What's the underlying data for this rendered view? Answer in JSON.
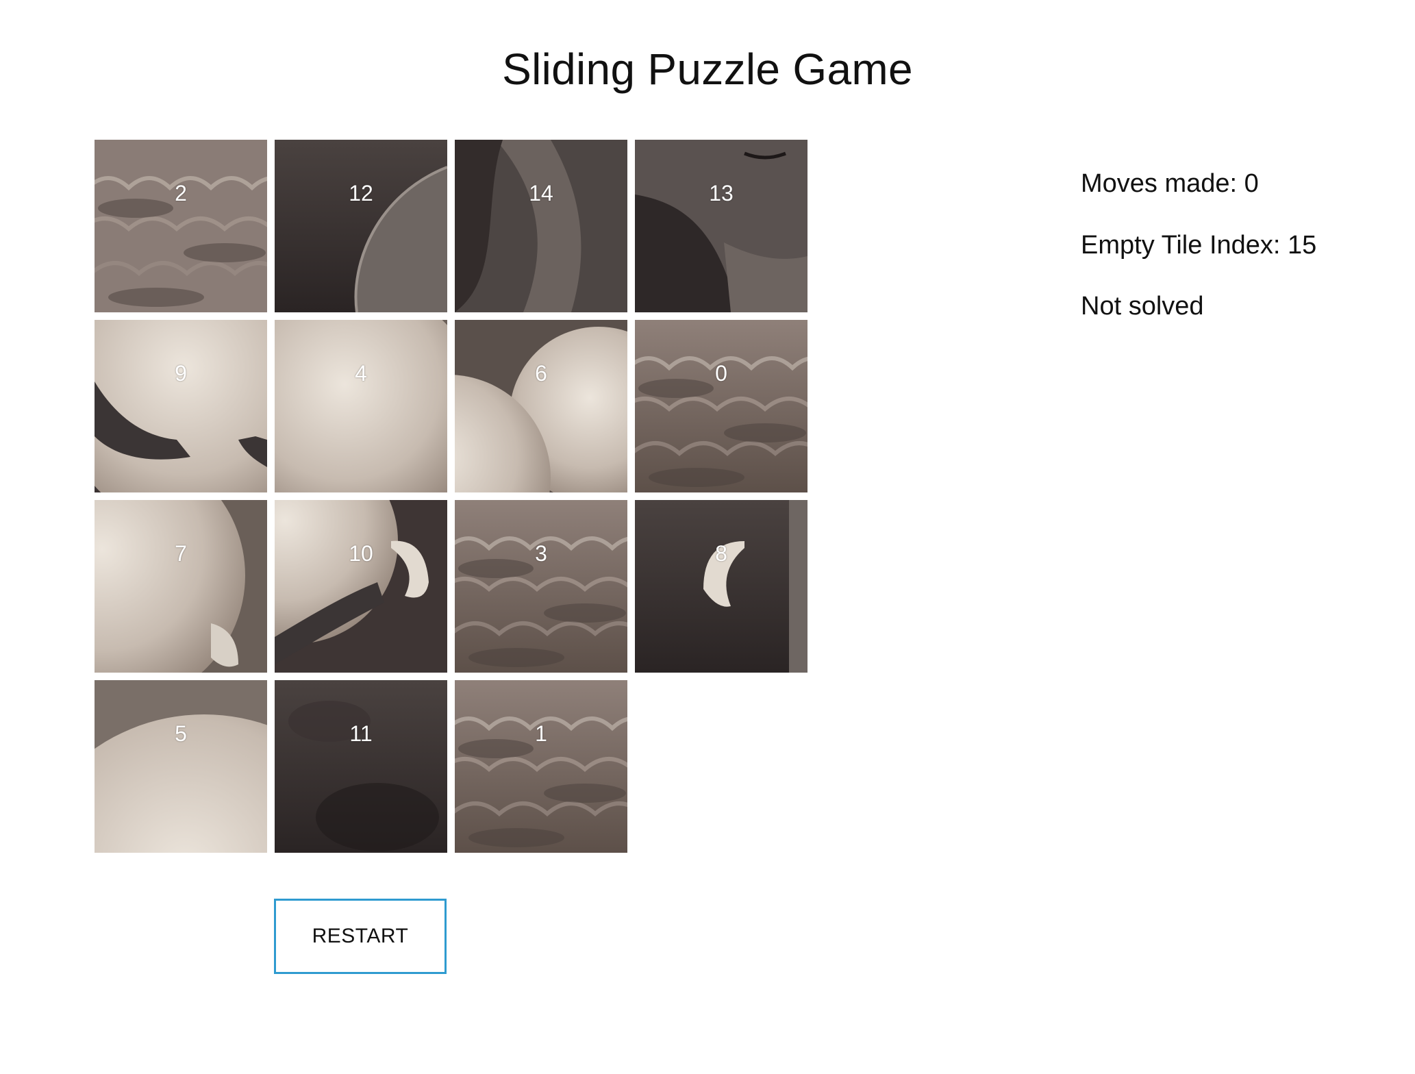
{
  "title": "Sliding Puzzle Game",
  "board": {
    "tiles": [
      {
        "label": "2",
        "theme": "clouds-light"
      },
      {
        "label": "12",
        "theme": "dark-arc"
      },
      {
        "label": "14",
        "theme": "dark-curve"
      },
      {
        "label": "13",
        "theme": "dark-robe"
      },
      {
        "label": "9",
        "theme": "sphere-horns"
      },
      {
        "label": "4",
        "theme": "sphere"
      },
      {
        "label": "6",
        "theme": "sphere-edge"
      },
      {
        "label": "0",
        "theme": "clouds"
      },
      {
        "label": "7",
        "theme": "sphere-ear"
      },
      {
        "label": "10",
        "theme": "sphere-ear-horn"
      },
      {
        "label": "3",
        "theme": "clouds"
      },
      {
        "label": "8",
        "theme": "dark-ear"
      },
      {
        "label": "5",
        "theme": "sphere-bottom"
      },
      {
        "label": "11",
        "theme": "dark"
      },
      {
        "label": "1",
        "theme": "clouds"
      }
    ],
    "empty_slot": "empty"
  },
  "controls": {
    "restart_label": "RESTART",
    "restart_border_color": "#2f9bd0"
  },
  "stats": {
    "moves_text": "Moves made: 0",
    "empty_index_text": "Empty Tile Index: 15",
    "solved_text": "Not solved"
  }
}
